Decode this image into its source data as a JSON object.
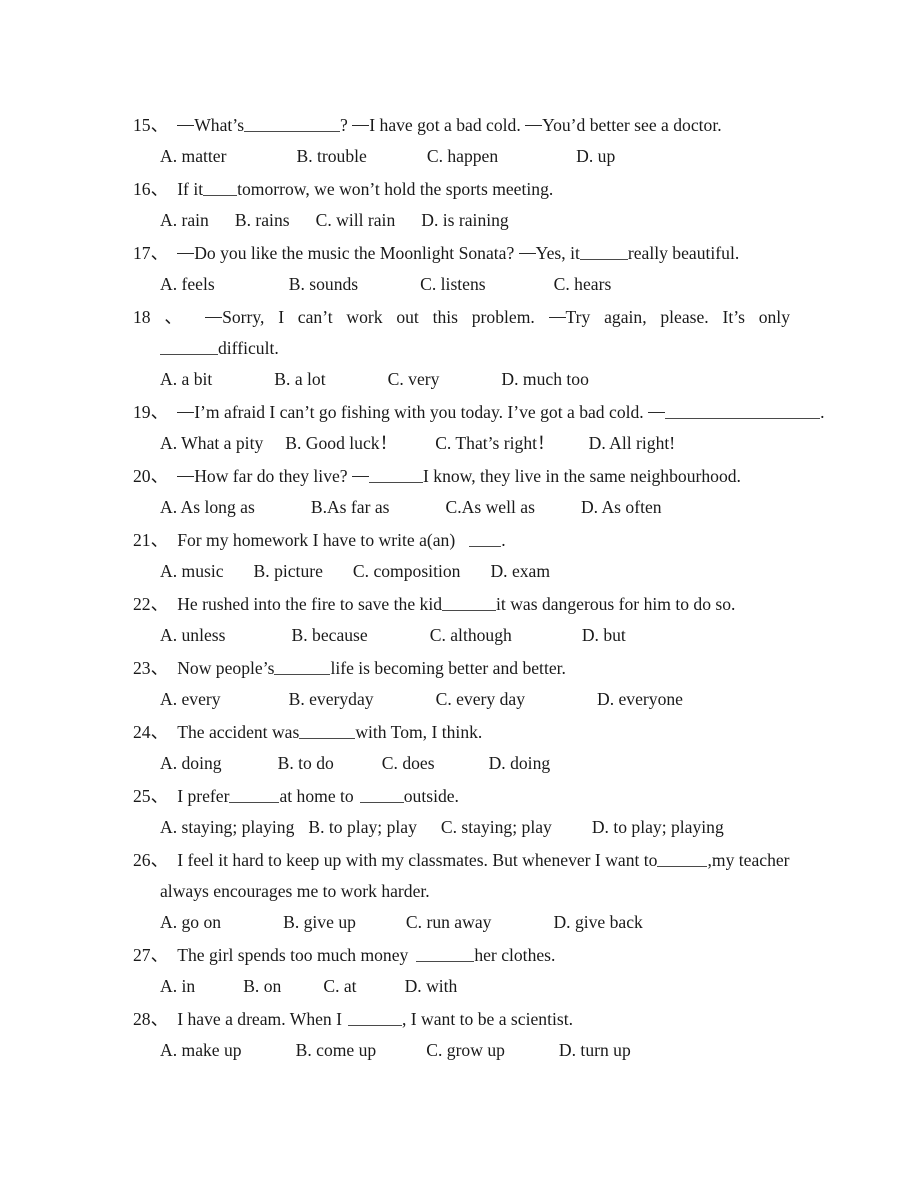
{
  "document": {
    "type": "english-multiple-choice-exercise",
    "questions": [
      {
        "number": "15",
        "mark": "、",
        "stem_pre": "—What’s",
        "blank_width": 96,
        "stem_post": "? —I have got a bad cold. —You’d better see a doctor.",
        "options": [
          "A. matter",
          "B. trouble",
          "C. happen",
          "D. up"
        ],
        "option_gaps": [
          70,
          60,
          78
        ]
      },
      {
        "number": "16",
        "mark": "、",
        "stem_pre": "If it",
        "blank_width": 34,
        "stem_post": "tomorrow, we won’t hold the sports meeting.",
        "options": [
          "A. rain",
          "B. rains",
          "C. will rain",
          "D. is raining"
        ],
        "option_gaps": [
          26,
          26,
          26
        ]
      },
      {
        "number": "17",
        "mark": "、",
        "stem_pre": "—Do you like the music the Moonlight Sonata? —Yes, it",
        "blank_width": 48,
        "stem_post": "really beautiful.",
        "options": [
          "A. feels",
          "B. sounds",
          "C. listens",
          "C. hears"
        ],
        "option_gaps": [
          74,
          62,
          68
        ]
      },
      {
        "number": "18",
        "mark": " 、",
        "justified_line": "—Sorry, I can’t work out this problem. —Try again, please. It’s only",
        "second_line_blank_width": 58,
        "second_line_text": "difficult.",
        "options": [
          "A. a bit",
          "B. a lot",
          "C. very",
          "D. much too"
        ],
        "option_gaps": [
          62,
          62,
          62
        ]
      },
      {
        "number": "19",
        "mark": "、",
        "stem_pre": "—I’m afraid I can’t go fishing with you today. I’ve got a bad cold. —",
        "blank_width": 155,
        "stem_post": ".",
        "options": [
          "A. What a pity",
          "B. Good luck！",
          "C. That’s right！",
          "D. All right!"
        ],
        "option_gaps": [
          22,
          38,
          34
        ]
      },
      {
        "number": "20",
        "mark": "、",
        "stem_pre": "—How far do they live? —",
        "blank_width": 54,
        "stem_post": "I know, they live in the same neighbourhood.",
        "options": [
          "A. As long as",
          "B.As far as",
          "C.As well as",
          "D. As often"
        ],
        "option_gaps": [
          56,
          56,
          46
        ]
      },
      {
        "number": "21",
        "mark": "、",
        "stem_pre": "For my homework I have to write a(an)",
        "blank_width": 32,
        "stem_post": ".",
        "stem_gap": 14,
        "options": [
          "A. music",
          "B. picture",
          "C. composition",
          "D. exam"
        ],
        "option_gaps": [
          30,
          30,
          30
        ]
      },
      {
        "number": "22",
        "mark": "、",
        "stem_pre": "He rushed into the fire to save the kid",
        "blank_width": 54,
        "stem_post": "it was dangerous for him to do so.",
        "options": [
          "A. unless",
          "B. because",
          "C. although",
          "D. but"
        ],
        "option_gaps": [
          66,
          62,
          70
        ]
      },
      {
        "number": "23",
        "mark": "、",
        "stem_pre": "Now people’s",
        "blank_width": 56,
        "stem_post": "life is becoming better and better.",
        "options": [
          "A. every",
          "B. everyday",
          "C. every day",
          "D. everyone"
        ],
        "option_gaps": [
          68,
          62,
          72
        ]
      },
      {
        "number": "24",
        "mark": "、",
        "stem_pre": "The accident was",
        "blank_width": 56,
        "stem_post": "with Tom, I think.",
        "options": [
          "A. doing",
          "B. to do",
          "C. does",
          "D. doing"
        ],
        "option_gaps": [
          56,
          48,
          54
        ]
      },
      {
        "number": "25",
        "mark": "、",
        "stem_pre": "I prefer",
        "blank_width": 50,
        "stem_mid": "at home to",
        "blank2_width": 44,
        "stem_post": "outside.",
        "options": [
          "A. staying; playing",
          "B. to play; play",
          "C. staying; play",
          "D. to play; playing"
        ],
        "option_gaps": [
          14,
          24,
          40
        ]
      },
      {
        "number": "26",
        "mark": "、",
        "stem_pre": "I feel it hard to keep up with my classmates. But whenever I want to",
        "blank_width": 50,
        "stem_post": ",my teacher",
        "second_line_text": "always encourages me to work harder.",
        "options": [
          "A. go on",
          "B. give up",
          "C. run away",
          "D. give back"
        ],
        "option_gaps": [
          62,
          50,
          62
        ]
      },
      {
        "number": "27",
        "mark": "、",
        "stem_pre": "The girl spends too much money",
        "blank_width": 58,
        "stem_post": "her clothes.",
        "stem_gap": 8,
        "options": [
          "A. in",
          "B. on",
          "C. at",
          "D. with"
        ],
        "option_gaps": [
          48,
          42,
          48
        ]
      },
      {
        "number": "28",
        "mark": "、",
        "stem_pre": "I have a dream. When I",
        "blank_width": 54,
        "stem_post": ", I want to be a scientist.",
        "stem_gap": 6,
        "options": [
          "A. make up",
          "B. come up",
          "C. grow up",
          "D. turn up"
        ],
        "option_gaps": [
          54,
          50,
          54
        ]
      }
    ]
  }
}
